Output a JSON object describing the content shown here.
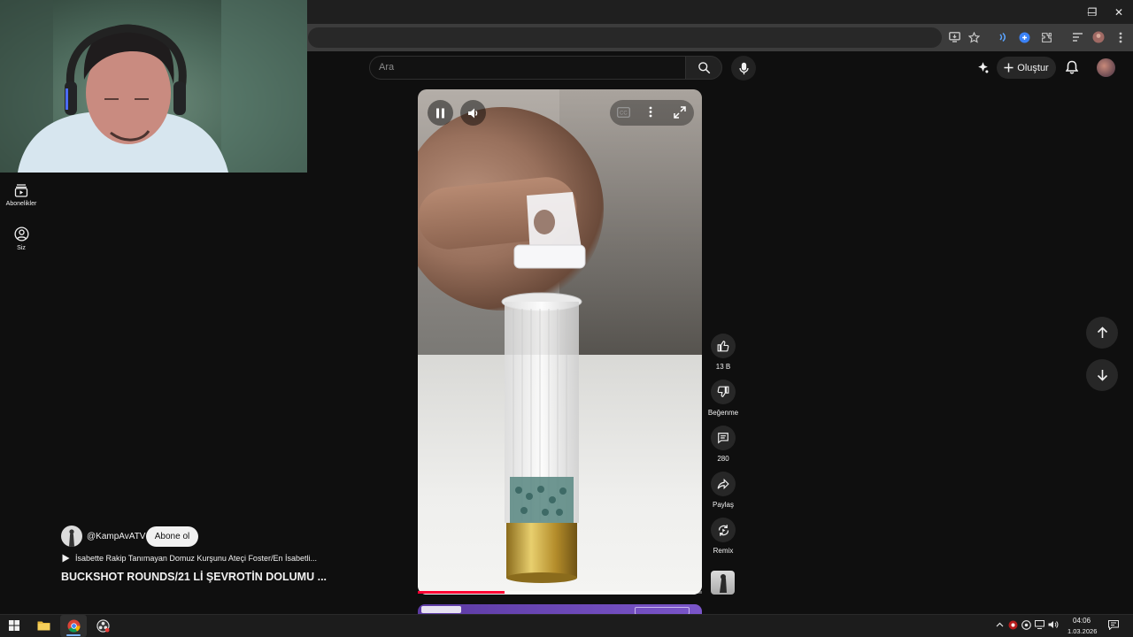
{
  "browser": {
    "window_controls": {
      "minimize": "─",
      "restore": "❐",
      "close": "✕"
    },
    "toolbar_icons": [
      "install-app-icon",
      "bookmark-star-icon",
      "media-icon",
      "extension-blue-icon",
      "puzzle-extensions-icon",
      "reading-list-icon",
      "profile-icon",
      "menu-dots-icon"
    ]
  },
  "youtube": {
    "search": {
      "placeholder": "Ara"
    },
    "header": {
      "create_label": "Oluştur"
    },
    "sidebar": {
      "items": [
        {
          "label": "Abonelikler",
          "icon": "subscriptions-icon"
        },
        {
          "label": "Siz",
          "icon": "you-icon"
        }
      ]
    },
    "actions": {
      "like_count": "13 B",
      "dislike_label": "Beğenme",
      "comment_count": "280",
      "share_label": "Paylaş",
      "remix_label": "Remix"
    },
    "channel": {
      "handle": "@KampAvATV",
      "subscribe_label": "Abone ol"
    },
    "playlist": {
      "title": "İsabette Rakip Tanımayan Domuz Kurşunu Ateçi Foster/En İsabetli..."
    },
    "video": {
      "title": "BUCKSHOT ROUNDS/21 Lİ ŞEVROTİN DOLUMU ...",
      "progress": 0.305
    },
    "colors": {
      "progress": "#ff0033",
      "background": "#0f0f0f"
    }
  },
  "taskbar": {
    "time": "04:06",
    "date": "1.03.2026"
  }
}
